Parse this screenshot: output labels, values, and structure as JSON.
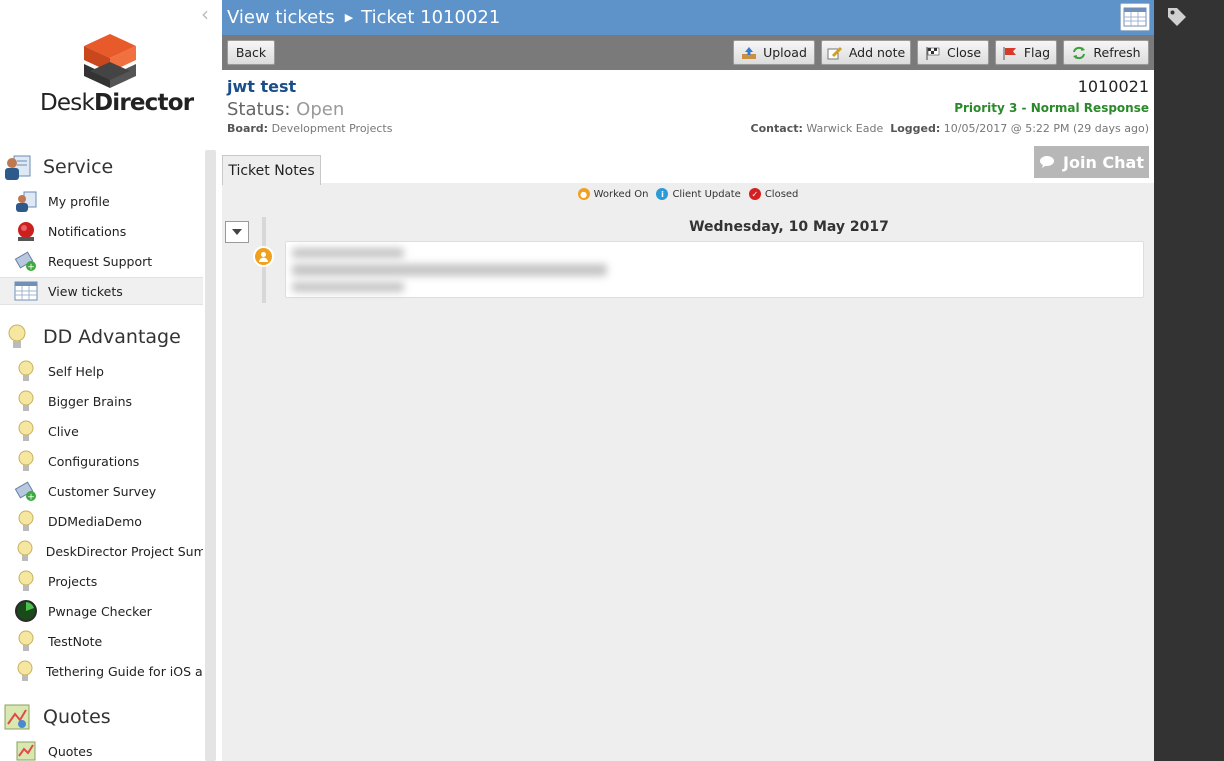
{
  "app": {
    "brand_part1": "Desk",
    "brand_part2": "Director"
  },
  "sidebar": {
    "sections": [
      {
        "title": "Service",
        "icon": "service-icon",
        "items": [
          {
            "label": "My profile",
            "icon": "profile-icon"
          },
          {
            "label": "Notifications",
            "icon": "alarm-icon"
          },
          {
            "label": "Request Support",
            "icon": "ticket-add-icon"
          },
          {
            "label": "View tickets",
            "icon": "table-icon",
            "active": true
          }
        ]
      },
      {
        "title": "DD Advantage",
        "icon": "lightbulb-icon",
        "items": [
          {
            "label": "Self Help",
            "icon": "lightbulb-icon"
          },
          {
            "label": "Bigger Brains",
            "icon": "lightbulb-icon"
          },
          {
            "label": "Clive",
            "icon": "lightbulb-icon"
          },
          {
            "label": "Configurations",
            "icon": "lightbulb-icon"
          },
          {
            "label": "Customer Survey",
            "icon": "ticket-add-icon"
          },
          {
            "label": "DDMediaDemo",
            "icon": "lightbulb-icon"
          },
          {
            "label": "DeskDirector Project Summ",
            "icon": "lightbulb-icon"
          },
          {
            "label": "Projects",
            "icon": "lightbulb-icon"
          },
          {
            "label": "Pwnage Checker",
            "icon": "radar-icon"
          },
          {
            "label": "TestNote",
            "icon": "lightbulb-icon"
          },
          {
            "label": "Tethering Guide for iOS anc",
            "icon": "lightbulb-icon"
          }
        ]
      },
      {
        "title": "Quotes",
        "icon": "quotes-icon",
        "items": [
          {
            "label": "Quotes",
            "icon": "quotes-icon"
          }
        ]
      }
    ]
  },
  "breadcrumb": {
    "parent": "View tickets",
    "current": "Ticket 1010021"
  },
  "toolbar": {
    "back": "Back",
    "upload": "Upload",
    "add_note": "Add note",
    "close": "Close",
    "flag": "Flag",
    "refresh": "Refresh"
  },
  "ticket": {
    "title": "jwt test",
    "status_label": "Status:",
    "status": "Open",
    "board_label": "Board:",
    "board": "Development Projects",
    "number": "1010021",
    "priority": "Priority 3 - Normal Response",
    "contact_label": "Contact:",
    "contact": "Warwick Eade",
    "logged_label": "Logged:",
    "logged": "10/05/2017 @ 5:22 PM (29 days ago)"
  },
  "tabs": {
    "notes": "Ticket Notes"
  },
  "chat": {
    "join": "Join Chat"
  },
  "legend": [
    {
      "label": "Worked On",
      "color": "#f0a020",
      "icon": "person-icon"
    },
    {
      "label": "Client Update",
      "color": "#2a9bd6",
      "icon": "info-icon"
    },
    {
      "label": "Closed",
      "color": "#d42020",
      "icon": "check-icon"
    }
  ],
  "timeline": {
    "date": "Wednesday, 10 May 2017"
  },
  "colors": {
    "titlebar": "#5d93c9",
    "toolbar": "#7a7a7a",
    "priority": "#2a8a2a",
    "right_panel": "#333333"
  }
}
